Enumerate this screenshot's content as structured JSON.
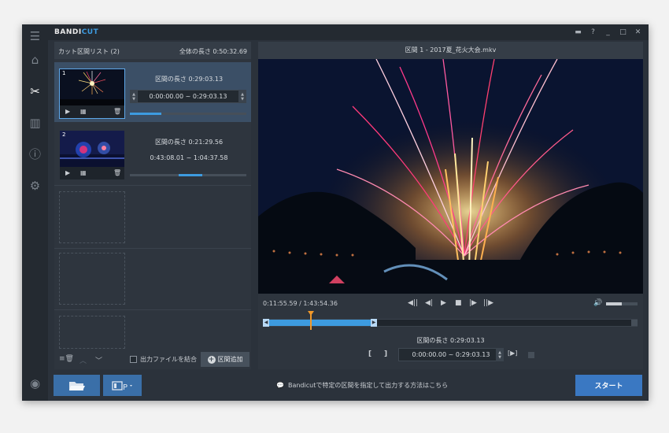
{
  "app": {
    "logo_main": "BANDI",
    "logo_accent": "CUT"
  },
  "titlebar": {
    "folder": "▬",
    "help": "?",
    "minimize": "_",
    "maximize": "□",
    "close": "✕"
  },
  "sidebar": {
    "menu": "☰",
    "home": "⌂",
    "cut": "✂",
    "join": "▥",
    "info": "ⓘ",
    "settings": "⚙",
    "record": "◉"
  },
  "segment_list": {
    "header": "カット区間リスト (2)",
    "total_length": "全体の長さ 0:50:32.69",
    "segments": [
      {
        "number": "1",
        "length": "区間の長さ 0:29:03.13",
        "range": "0:00:00.00 ~ 0:29:03.13",
        "progress": 0.27
      },
      {
        "number": "2",
        "length": "区間の長さ 0:21:29.56",
        "range": "0:43:08.01 ~ 1:04:37.58",
        "progress": 0.2
      }
    ],
    "merge_label": "出力ファイルを結合",
    "add_label": "区間追加",
    "delete_all": "≡🗑",
    "up": "︿",
    "down": "﹀"
  },
  "player": {
    "title": "区間 1 - 2017夏_花火大会.mkv",
    "timecode": "0:11:55.59 / 1:43:54.36",
    "controls": {
      "prev_mark": "◀||",
      "prev_frame": "◀|",
      "play": "▶",
      "stop": "■",
      "next_frame": "|▶",
      "next_mark": "||▶"
    },
    "volume_icon": "🔊",
    "volume": 0.5,
    "segment_length": "区間の長さ 0:29:03.13",
    "segment_range": "0:00:00.00 ~ 0:29:03.13",
    "bracket_start": "[",
    "bracket_end": "]",
    "play_segment": "[▶]"
  },
  "bottom": {
    "hint": "Bandicutで特定の区間を指定して出力する方法はこちら",
    "start_label": "スタート"
  }
}
